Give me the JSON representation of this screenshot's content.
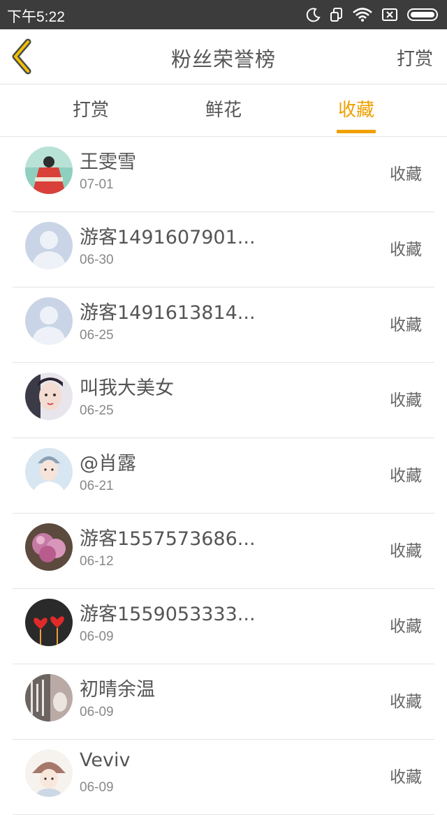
{
  "status_bar": {
    "time": "下午5:22",
    "icons": [
      "moon-icon",
      "rotate-icon",
      "wifi-icon",
      "sim-off-icon",
      "battery-icon"
    ]
  },
  "header": {
    "title": "粉丝荣誉榜",
    "action": "打赏",
    "back_icon": "chevron-left-icon"
  },
  "tabs": [
    {
      "label": "打赏",
      "active": false
    },
    {
      "label": "鲜花",
      "active": false
    },
    {
      "label": "收藏",
      "active": true
    }
  ],
  "colors": {
    "accent": "#f0a000",
    "status_bar": "#3c3c3c",
    "text": "#555555",
    "divider": "#e4e4e4"
  },
  "fans": [
    {
      "name": "王雯雪",
      "date": "07-01",
      "action": "收藏",
      "avatar": "red-dress-photo"
    },
    {
      "name": "游客1491607901...",
      "date": "06-30",
      "action": "收藏",
      "avatar": "default-user"
    },
    {
      "name": "游客1491613814...",
      "date": "06-25",
      "action": "收藏",
      "avatar": "default-user"
    },
    {
      "name": "叫我大美女",
      "date": "06-25",
      "action": "收藏",
      "avatar": "portrait-photo"
    },
    {
      "name": "@肖露",
      "date": "06-21",
      "action": "收藏",
      "avatar": "portrait-cap-photo"
    },
    {
      "name": "游客1557573686...",
      "date": "06-12",
      "action": "收藏",
      "avatar": "flower-photo"
    },
    {
      "name": "游客1559053333...",
      "date": "06-09",
      "action": "收藏",
      "avatar": "hearts-photo"
    },
    {
      "name": "初晴余温",
      "date": "06-09",
      "action": "收藏",
      "avatar": "calligraphy-photo"
    },
    {
      "name": "Veviv",
      "date": "06-09",
      "action": "收藏",
      "avatar": "illustration-girl"
    }
  ]
}
